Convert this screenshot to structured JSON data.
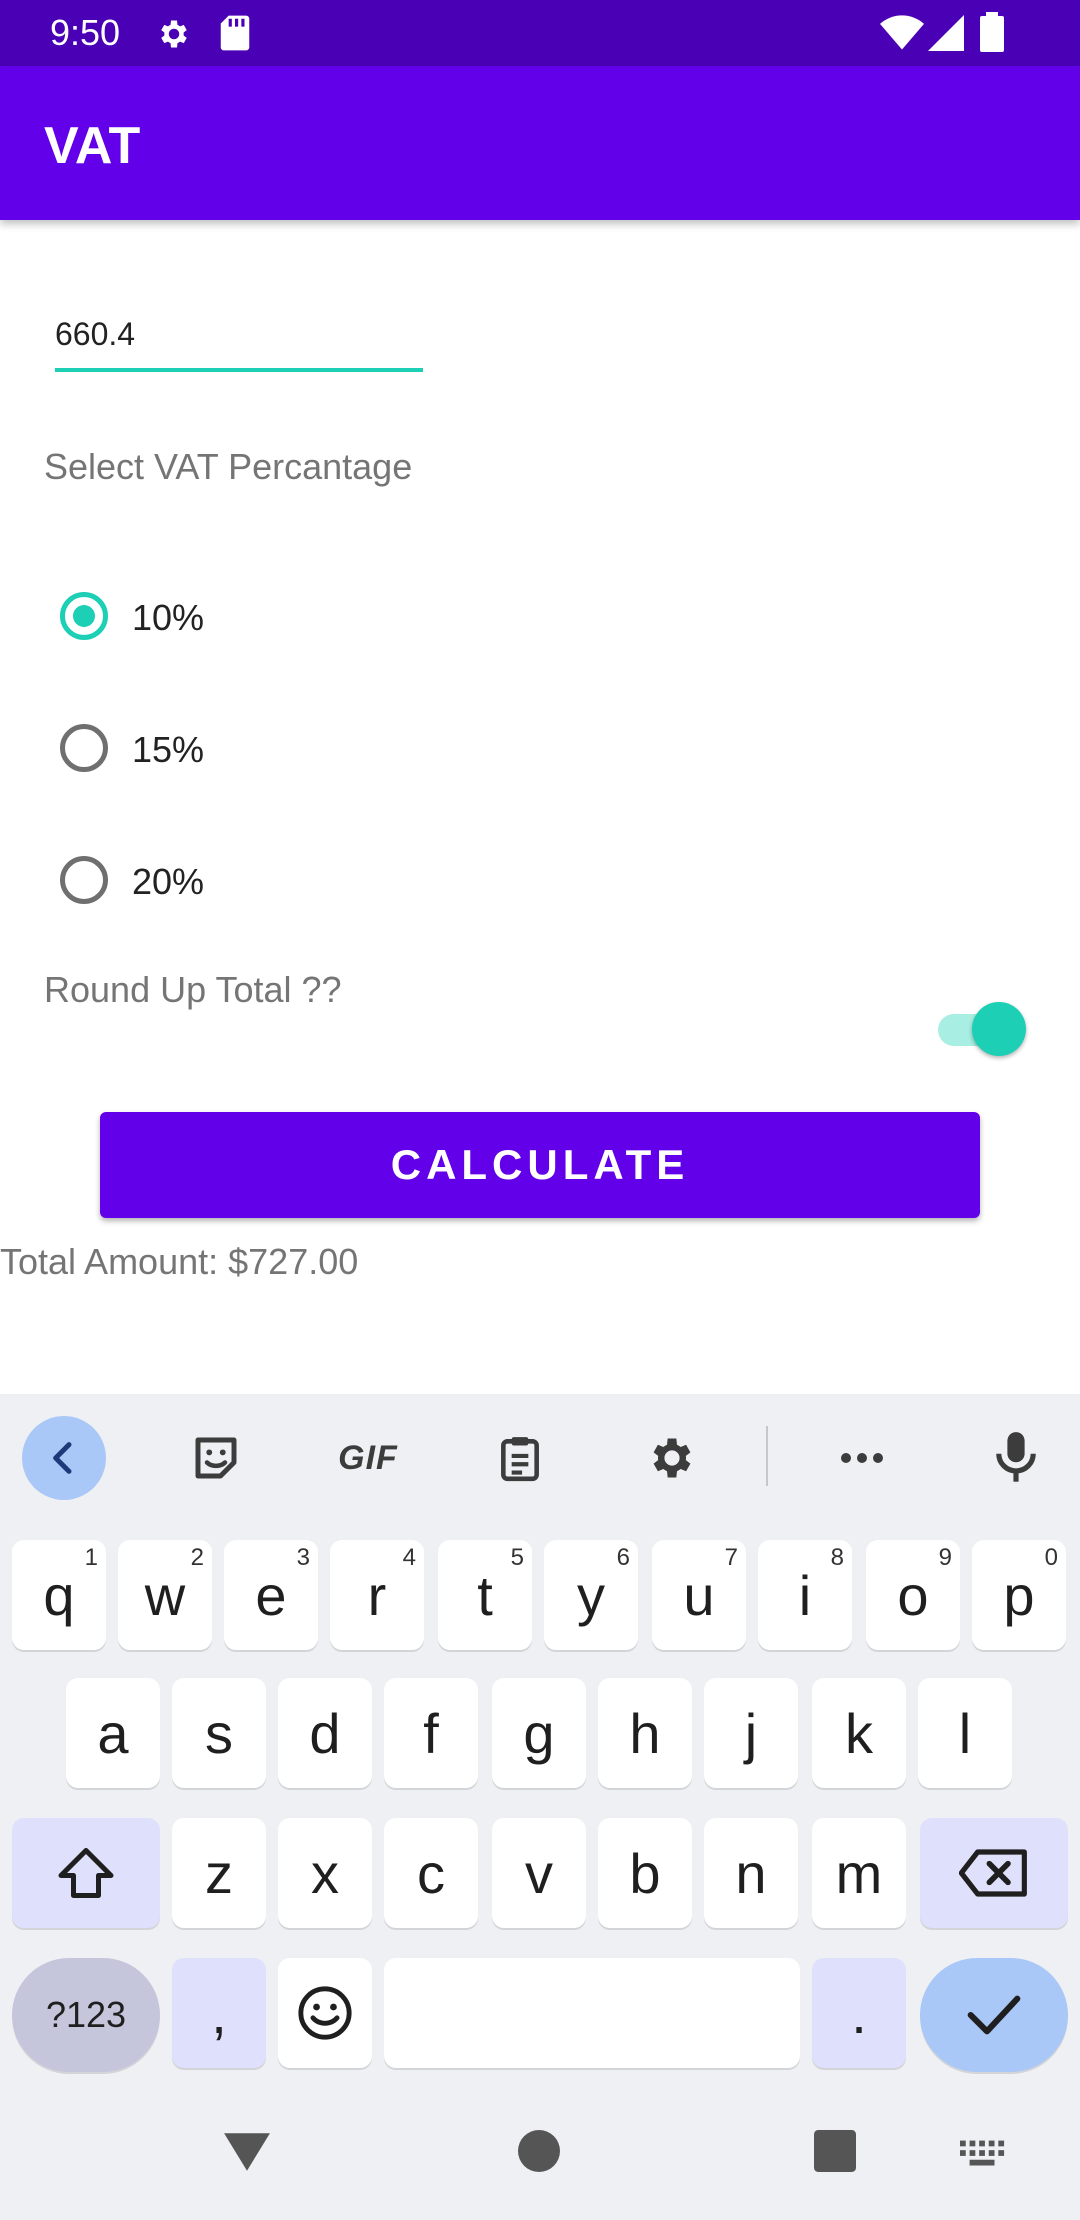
{
  "status_bar": {
    "time": "9:50",
    "icons": [
      "settings-icon",
      "sd-card-icon",
      "wifi-icon",
      "signal-icon",
      "battery-icon"
    ]
  },
  "app_bar": {
    "title": "VAT"
  },
  "form": {
    "amount_value": "660.4",
    "vat_label": "Select VAT Percantage",
    "options": [
      {
        "label": "10%",
        "selected": true
      },
      {
        "label": "15%",
        "selected": false
      },
      {
        "label": "20%",
        "selected": false
      }
    ],
    "round_label": "Round Up Total ??",
    "round_enabled": true,
    "calculate_label": "CALCULATE",
    "total_text": "Total Amount: $727.00"
  },
  "keyboard": {
    "toolbar": {
      "gif_label": "GIF"
    },
    "row1": [
      {
        "key": "q",
        "hint": "1"
      },
      {
        "key": "w",
        "hint": "2"
      },
      {
        "key": "e",
        "hint": "3"
      },
      {
        "key": "r",
        "hint": "4"
      },
      {
        "key": "t",
        "hint": "5"
      },
      {
        "key": "y",
        "hint": "6"
      },
      {
        "key": "u",
        "hint": "7"
      },
      {
        "key": "i",
        "hint": "8"
      },
      {
        "key": "o",
        "hint": "9"
      },
      {
        "key": "p",
        "hint": "0"
      }
    ],
    "row2": [
      "a",
      "s",
      "d",
      "f",
      "g",
      "h",
      "j",
      "k",
      "l"
    ],
    "row3": [
      "z",
      "x",
      "c",
      "v",
      "b",
      "n",
      "m"
    ],
    "row4": {
      "symbols_label": "?123",
      "comma": ",",
      "period": "."
    }
  },
  "colors": {
    "accent": "#1ccfb5",
    "primary": "#6200ea",
    "status_bar": "#4a00b5"
  }
}
